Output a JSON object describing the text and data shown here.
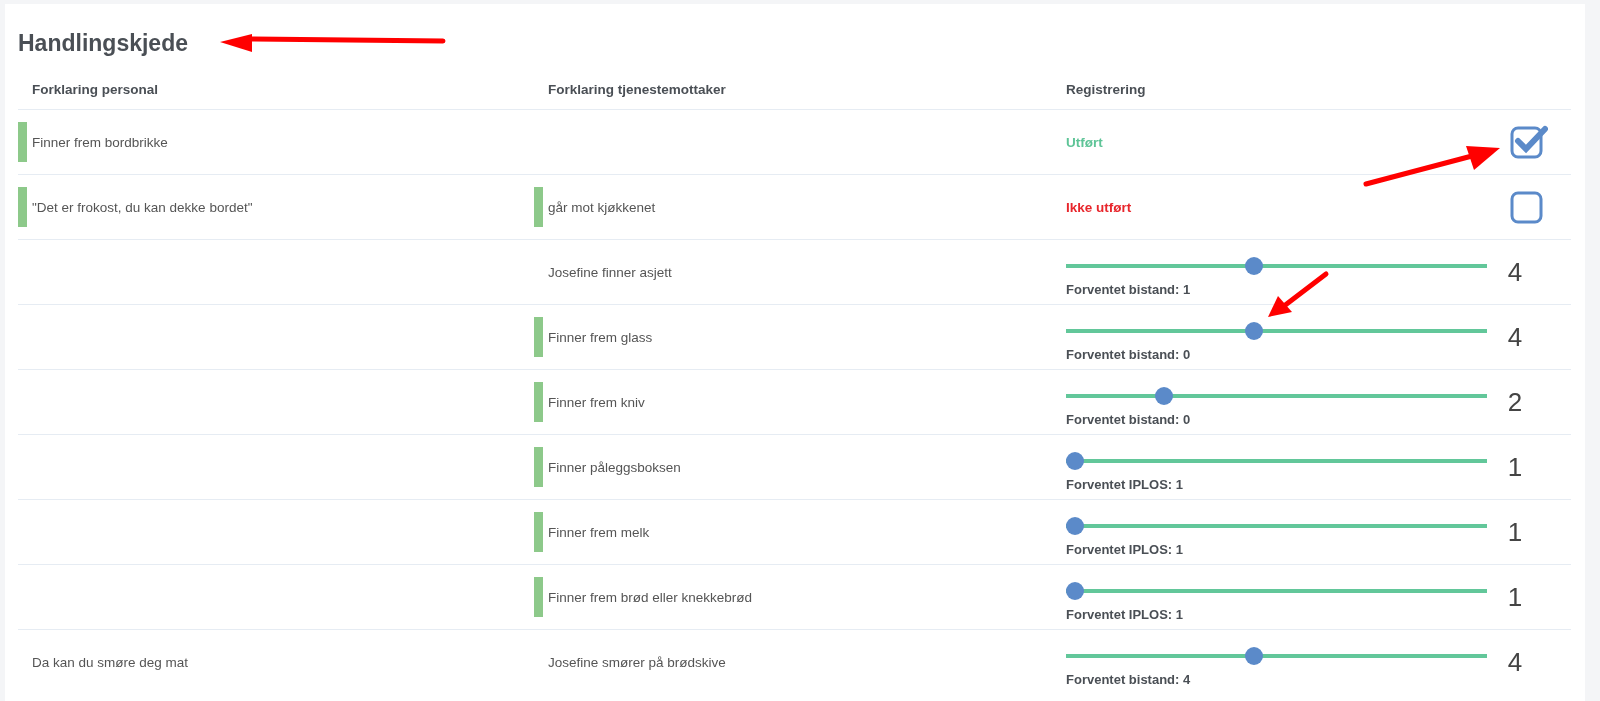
{
  "title": "Handlingskjede",
  "columns": [
    "Forklaring personal",
    "Forklaring tjenestemottaker",
    "Registrering"
  ],
  "rows": [
    {
      "kind": "checkbox",
      "staff": {
        "text": "Finner frem bordbrikke",
        "marker": true
      },
      "status": "Utført",
      "done": true,
      "checked": true
    },
    {
      "kind": "checkbox",
      "staff": {
        "text": "\"Det er frokost, du kan dekke bordet\"",
        "marker": true
      },
      "recipient": {
        "text": "går mot kjøkkenet",
        "marker": true
      },
      "status": "Ikke utført",
      "done": false,
      "checked": false
    },
    {
      "kind": "slider",
      "recipient": {
        "text": "Josefine finner asjett",
        "marker": false
      },
      "level": 0.444,
      "caption": "Forventet bistand: 1",
      "value": "4"
    },
    {
      "kind": "slider",
      "recipient": {
        "text": "Finner frem glass",
        "marker": true
      },
      "level": 0.444,
      "caption": "Forventet bistand: 0",
      "value": "4"
    },
    {
      "kind": "slider",
      "recipient": {
        "text": "Finner frem kniv",
        "marker": true
      },
      "level": 0.222,
      "caption": "Forventet bistand: 0",
      "value": "2"
    },
    {
      "kind": "slider",
      "recipient": {
        "text": "Finner påleggsboksen",
        "marker": true
      },
      "level": 0,
      "caption": "Forventet IPLOS: 1",
      "value": "1"
    },
    {
      "kind": "slider",
      "recipient": {
        "text": "Finner frem melk",
        "marker": true
      },
      "level": 0,
      "caption": "Forventet IPLOS: 1",
      "value": "1"
    },
    {
      "kind": "slider",
      "recipient": {
        "text": "Finner frem brød eller knekkebrød",
        "marker": true
      },
      "level": 0,
      "caption": "Forventet IPLOS: 1",
      "value": "1"
    },
    {
      "kind": "slider",
      "staff": {
        "text": "Da kan du smøre deg mat",
        "marker": false
      },
      "recipient": {
        "text": "Josefine smører på brødskive",
        "marker": false
      },
      "level": 0.444,
      "caption": "Forventet bistand: 4",
      "value": "4"
    }
  ]
}
